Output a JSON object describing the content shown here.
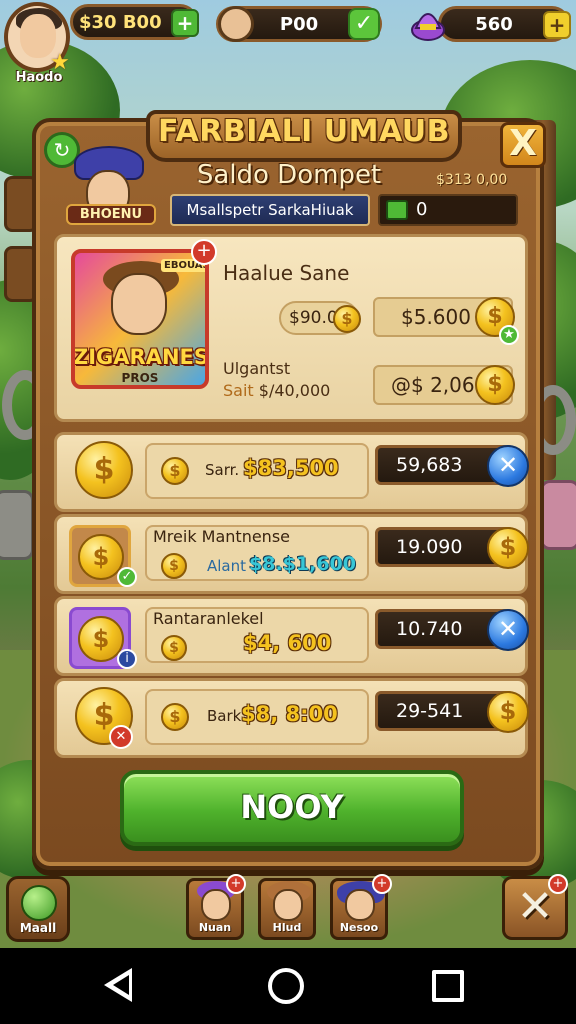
{
  "hud": {
    "player_name": "Haodo",
    "currency_1": "$30 B00",
    "currency_2": "P00",
    "currency_3": "560"
  },
  "panel": {
    "title": "FARBIALI UMAUB",
    "hero_label": "BHOENU",
    "subtitle": "Saldo Dompet",
    "subtitle_right": "$313 0,00",
    "search_text": "Msallspetr SarkaHiuak",
    "balance": "0",
    "close_label": "X"
  },
  "feature": {
    "card_banner": "EBOUAS",
    "card_title": "ZIGARANES",
    "card_subtitle": "PROS",
    "name": "Haalue Sane",
    "price_small": "$90.0",
    "price_a": "$5.600",
    "line2": "Ulgantst",
    "line3_key": "Sait",
    "line3_val": "$/40,000",
    "price_b": "@$ 2,060"
  },
  "rows": [
    {
      "label": "",
      "small": "Sarr.",
      "price": "$83,500",
      "value": "59,683",
      "action": "blue-x"
    },
    {
      "label": "Mreik Mantnense",
      "small": "Alant",
      "price": "$8.$1,600",
      "value": "19.090",
      "action": "coin"
    },
    {
      "label": "Rantaranlekel",
      "small": "",
      "price": "$4, 600",
      "value": "10.740",
      "action": "blue-x"
    },
    {
      "label": "",
      "small": "Bark",
      "price": "$8, 8:00",
      "value": "29-541",
      "action": "coin"
    }
  ],
  "ready_button": "NOOY",
  "bottom": {
    "menu_label": "Maall",
    "slots": [
      "Nuan",
      "Hlud",
      "Nesoo"
    ]
  },
  "colors": {
    "wood": "#7b4a20",
    "parchment": "#f4e1b6",
    "button_green": "#4fb22c",
    "coin_gold": "#f4c21f"
  }
}
